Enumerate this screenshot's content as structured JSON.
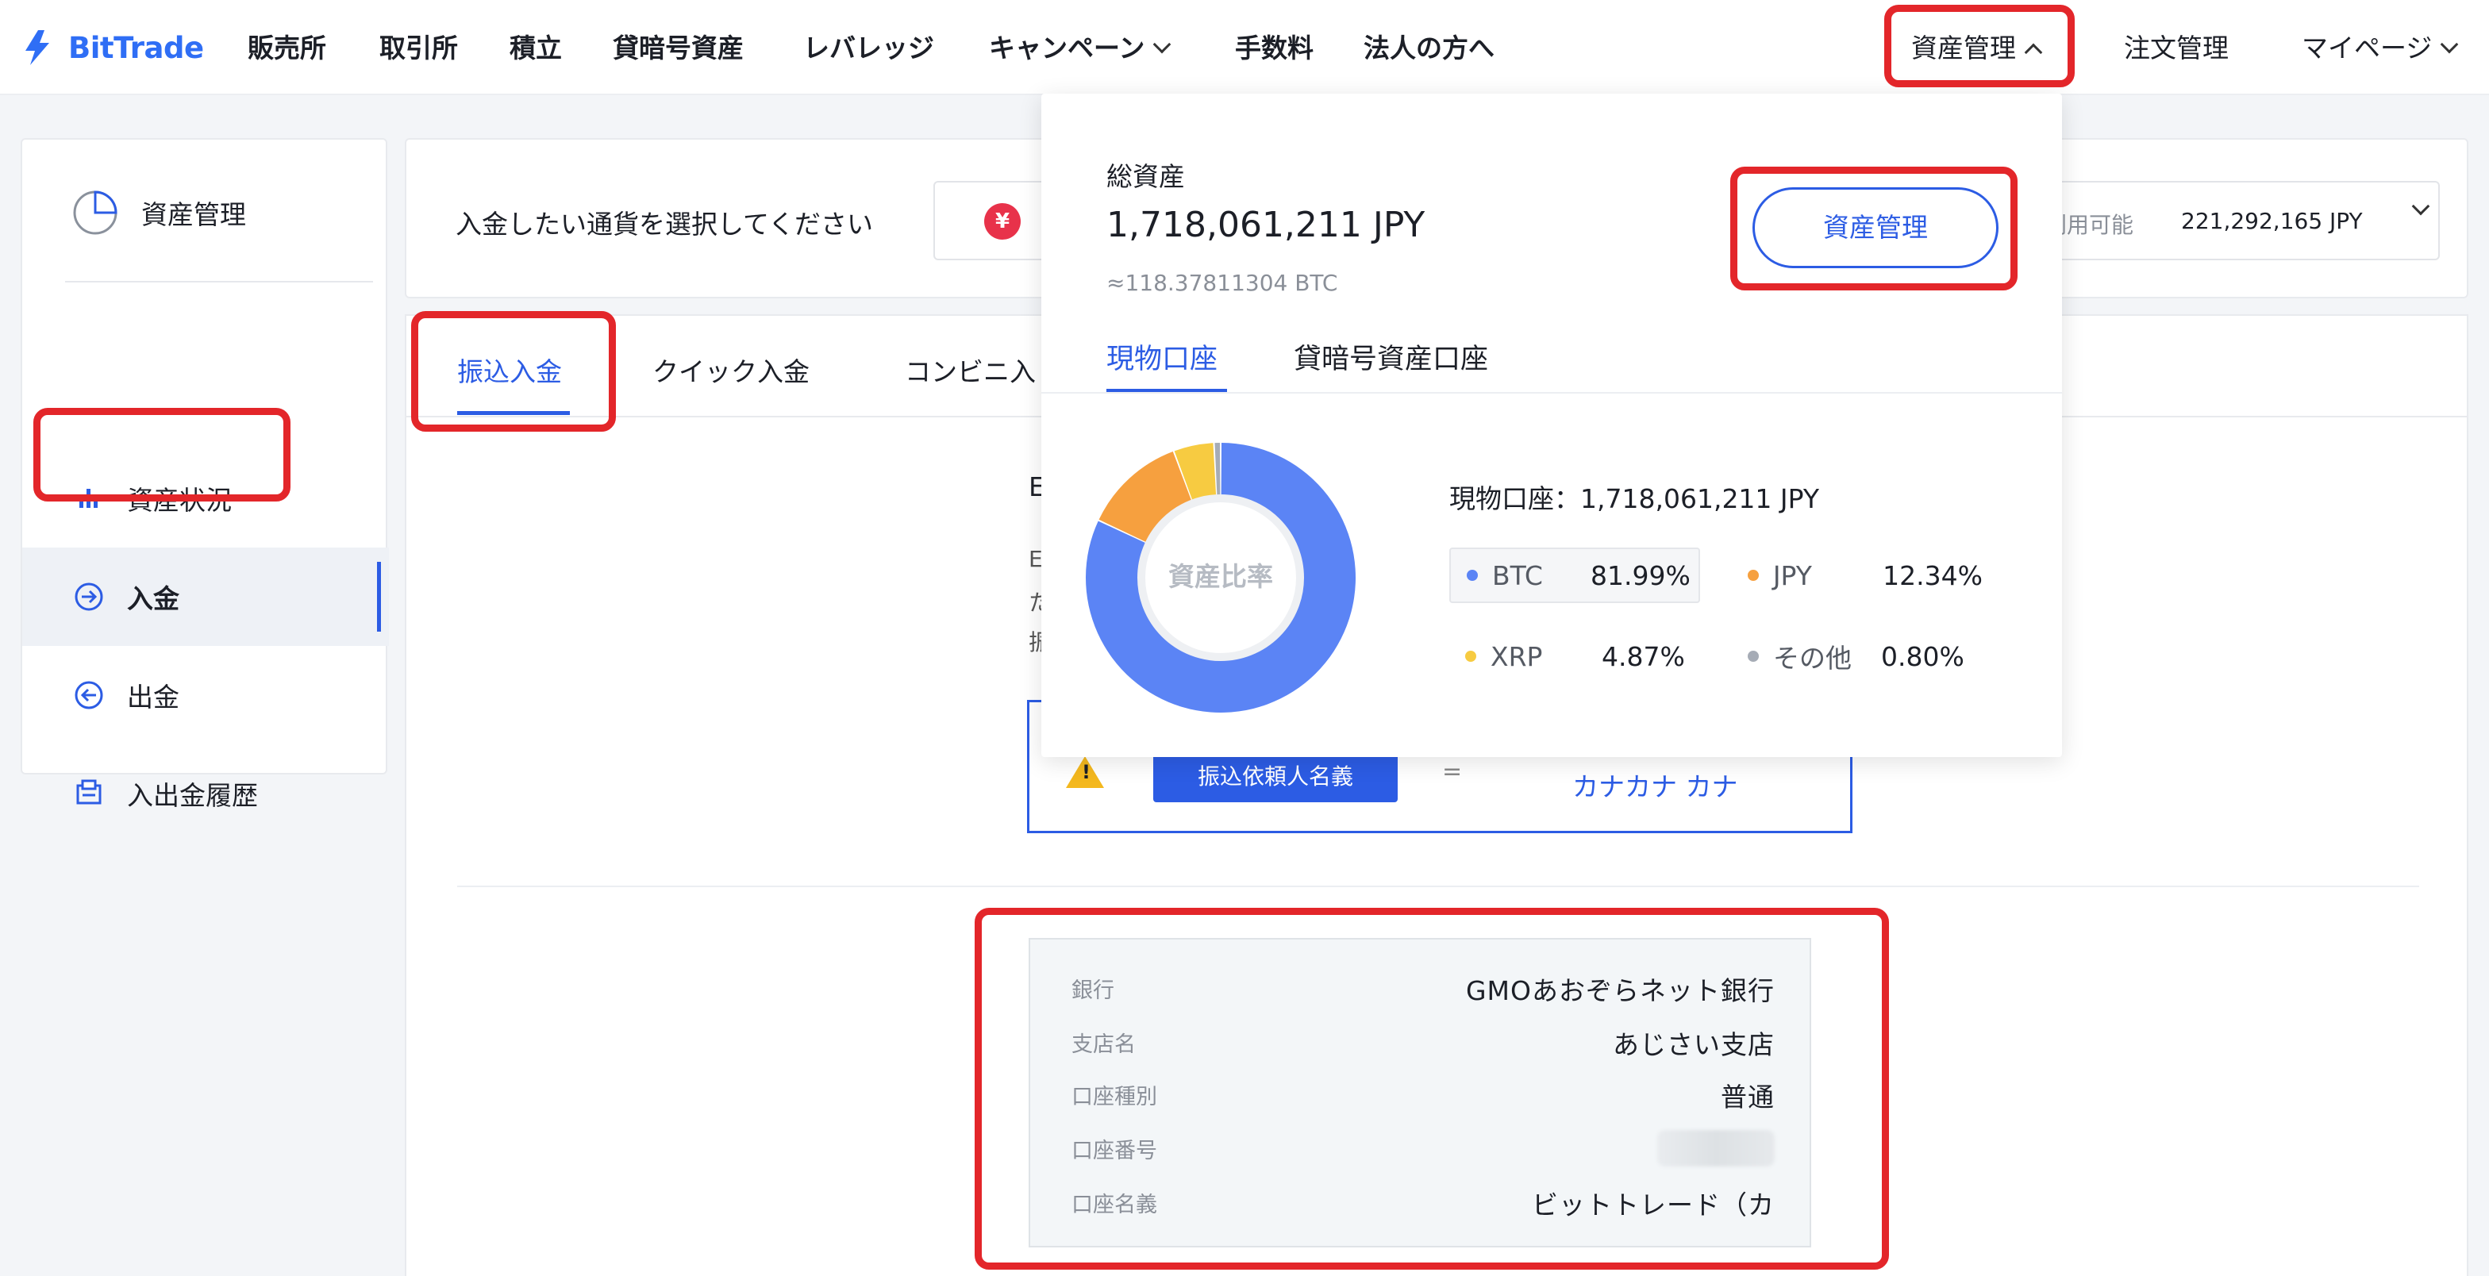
{
  "brand": {
    "name": "BitTrade",
    "accent": "#2c5ce4",
    "highlight": "#e3262a"
  },
  "nav": {
    "items": [
      "販売所",
      "取引所",
      "積立",
      "貸暗号資産",
      "レバレッジ",
      "キャンペーン",
      "手数料",
      "法人の方へ"
    ],
    "right": [
      "資産管理",
      "注文管理",
      "マイページ"
    ]
  },
  "sidebar": {
    "header": "資産管理",
    "items": [
      {
        "label": "資産状況",
        "icon": "bar-chart-icon"
      },
      {
        "label": "入金",
        "icon": "deposit-arrow-icon"
      },
      {
        "label": "出金",
        "icon": "withdraw-arrow-icon"
      },
      {
        "label": "入出金履歴",
        "icon": "history-icon"
      }
    ]
  },
  "deposit": {
    "select_label": "入金したい通貨を選択してください",
    "currency_symbol": "¥",
    "available_label": "利用可能",
    "available_value": "221,292,165 JPY",
    "tabs": [
      "振込入金",
      "クイック入金",
      "コンビニ入"
    ],
    "snippets": {
      "s1": "E",
      "s2": "E",
      "s3": "た",
      "s4": "振"
    },
    "notice": {
      "button": "振込依頼人名義",
      "eq": "=",
      "value": "カナカナ カナ"
    },
    "bank": [
      {
        "label": "銀行",
        "value": "GMOあおぞらネット銀行"
      },
      {
        "label": "支店名",
        "value": "あじさい支店"
      },
      {
        "label": "口座種別",
        "value": "普通"
      },
      {
        "label": "口座番号",
        "value": ""
      },
      {
        "label": "口座名義",
        "value": "ビットトレード（カ"
      }
    ]
  },
  "dropdown": {
    "total_label": "総資産",
    "total_value": "1,718,061,211 JPY",
    "btc_value": "≈118.37811304 BTC",
    "button": "資産管理",
    "tabs": [
      "現物口座",
      "貸暗号資産口座"
    ],
    "donut_center": "資産比率",
    "account_line": "現物口座：1,718,061,211 JPY",
    "legend": [
      {
        "name": "BTC",
        "pct": "81.99%",
        "color": "#5b84f5",
        "value": 81.99
      },
      {
        "name": "JPY",
        "pct": "12.34%",
        "color": "#f6a03f",
        "value": 12.34
      },
      {
        "name": "XRP",
        "pct": "4.87%",
        "color": "#f7cb41",
        "value": 4.87
      },
      {
        "name": "その他",
        "pct": "0.80%",
        "color": "#a6acb6",
        "value": 0.8
      }
    ]
  }
}
